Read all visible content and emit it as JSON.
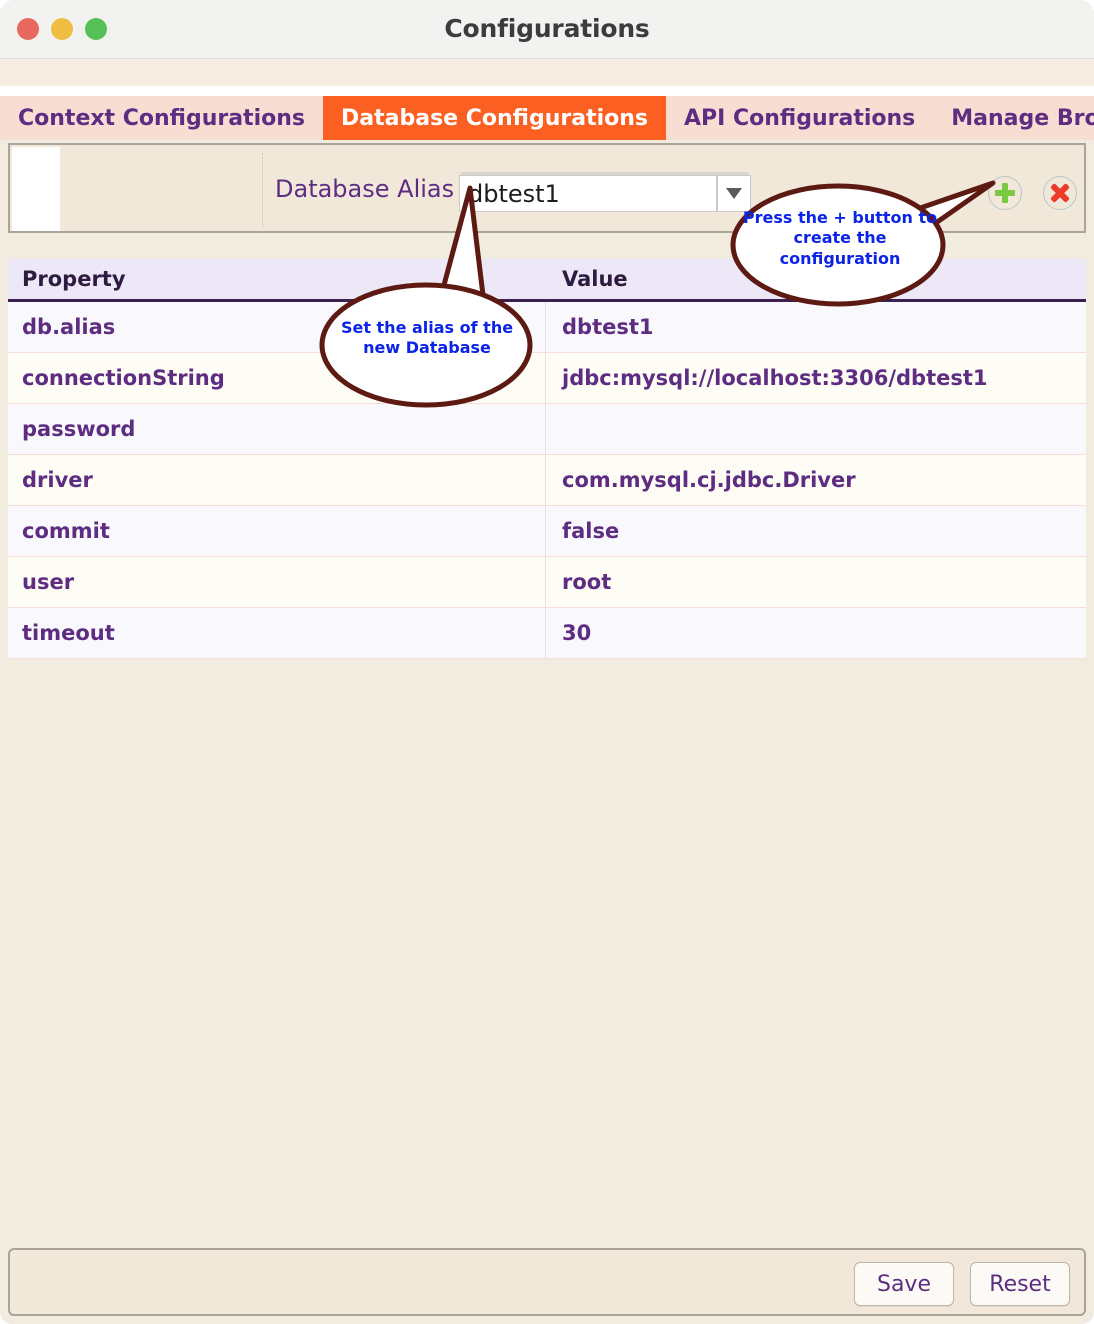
{
  "window": {
    "title": "Configurations",
    "traffic_lights": [
      "close-red",
      "minimize-yellow",
      "maximize-green"
    ]
  },
  "tabs": [
    {
      "label": "Context Configurations",
      "active": false
    },
    {
      "label": "Database Configurations",
      "active": true
    },
    {
      "label": "API Configurations",
      "active": false
    },
    {
      "label": "Manage Browsers",
      "active": false
    }
  ],
  "alias_panel": {
    "label": "Database Alias",
    "combo_value": "dbtest1",
    "combo_placeholder": "dbtest1",
    "dropdown_icon": "chevron-down-icon",
    "add_button_icon": "plus-icon",
    "delete_button_icon": "close-x-icon"
  },
  "table": {
    "headers": [
      "Property",
      "Value"
    ],
    "rows": [
      {
        "property": "db.alias",
        "value": "dbtest1"
      },
      {
        "property": "connectionString",
        "value": "jdbc:mysql://localhost:3306/dbtest1"
      },
      {
        "property": "password",
        "value": ""
      },
      {
        "property": "driver",
        "value": "com.mysql.cj.jdbc.Driver"
      },
      {
        "property": "commit",
        "value": "false"
      },
      {
        "property": "user",
        "value": "root"
      },
      {
        "property": "timeout",
        "value": "30"
      }
    ]
  },
  "callouts": [
    {
      "text": "Set the alias of the new Database",
      "points_to": "alias-input"
    },
    {
      "text": "Press the + button to create the configuration",
      "points_to": "add-button"
    }
  ],
  "footer": {
    "save_label": "Save",
    "reset_label": "Reset"
  },
  "colors": {
    "window_bg": "#f2ece0",
    "titlebar_bg": "#f2f2f0",
    "tab_bg": "#f8ddd3",
    "tab_active_bg": "#fb5f21",
    "tab_text": "#5e2d82",
    "tab_active_text": "#ffffff",
    "table_header_bg": "#ece8f7",
    "table_row_odd": "#f9f8fd",
    "table_row_even": "#fdfcf5",
    "text_purple": "#5e2d82",
    "callout_text": "#0b24e6",
    "callout_stroke": "#5c1a12",
    "plus_green": "#7ac943",
    "x_red": "#ec3b2a"
  }
}
